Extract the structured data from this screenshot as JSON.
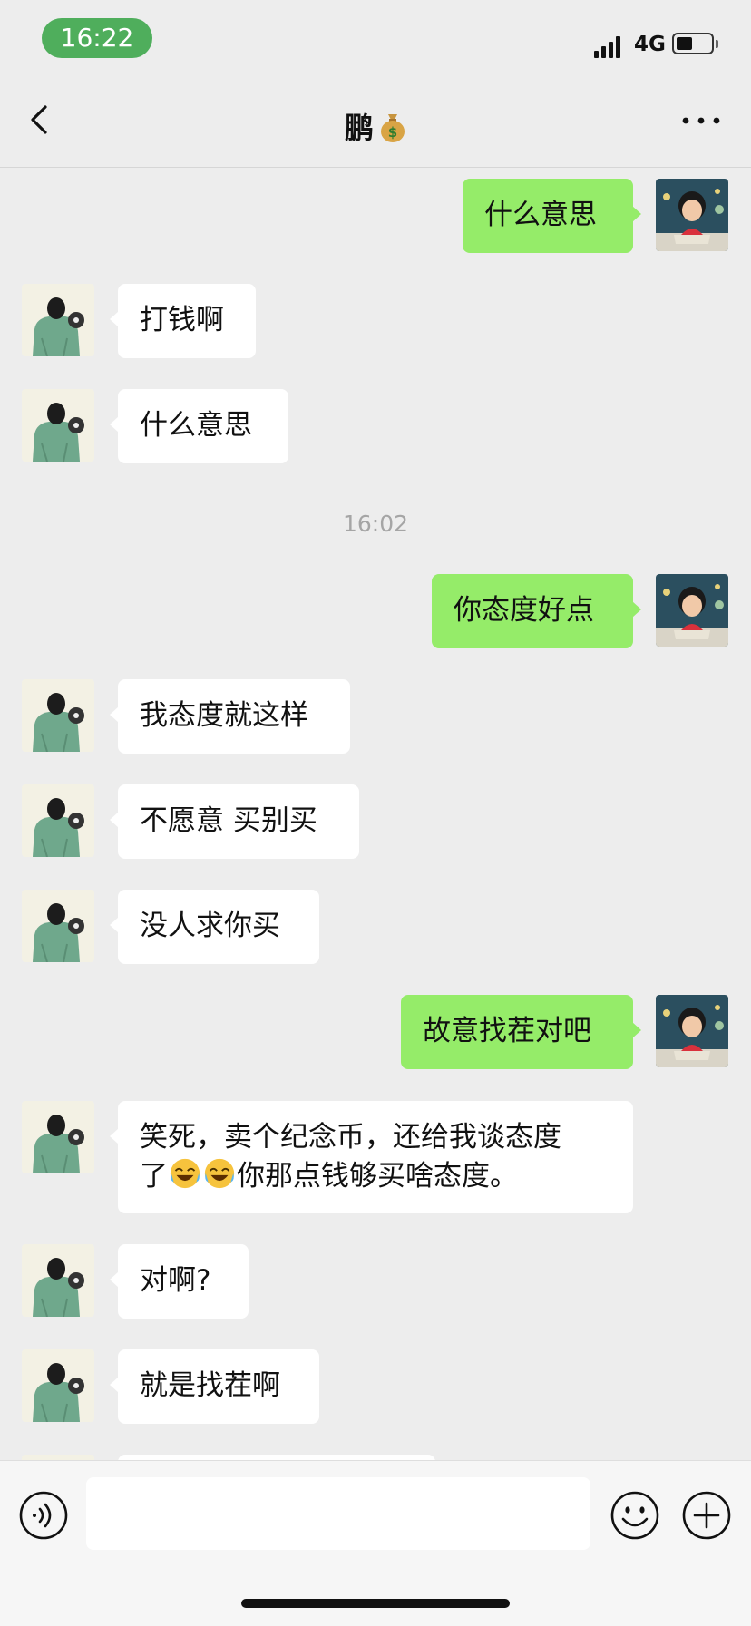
{
  "status_bar": {
    "time": "16:22",
    "network": "4G",
    "battery_level": 0.45,
    "time_pill_color": "#4fae5c"
  },
  "nav": {
    "title": "鹏",
    "title_icon": "money-bag-icon",
    "back_icon": "chevron-left-icon",
    "more_icon": "more-dots-icon"
  },
  "colors": {
    "background": "#ededed",
    "outgoing_bubble": "#95ec69",
    "incoming_bubble": "#ffffff",
    "timestamp_text": "#a5a5a5"
  },
  "timestamps": [
    "16:02"
  ],
  "messages": [
    {
      "direction": "out",
      "text": "什么意思"
    },
    {
      "direction": "in",
      "text": "打钱啊"
    },
    {
      "direction": "in",
      "text": "什么意思"
    },
    {
      "direction": "out",
      "text": "你态度好点"
    },
    {
      "direction": "in",
      "text": "我态度就这样"
    },
    {
      "direction": "in",
      "text": "不愿意 买别买"
    },
    {
      "direction": "in",
      "text": "没人求你买"
    },
    {
      "direction": "out",
      "text": "故意找茬对吧"
    },
    {
      "direction": "in",
      "text_line1": "笑死，卖个纪念币，还给我谈态度",
      "text_line2_prefix": "了",
      "text_line2_suffix": "你那点钱够买啥态度。",
      "emojis": [
        "rofl-emoji",
        "rofl-emoji"
      ]
    },
    {
      "direction": "in",
      "text": "对啊?"
    },
    {
      "direction": "in",
      "text": "就是找茬啊"
    }
  ],
  "input_bar": {
    "voice_icon": "voice-icon",
    "input_value": "",
    "emoji_icon": "emoji-icon",
    "plus_icon": "plus-icon"
  }
}
